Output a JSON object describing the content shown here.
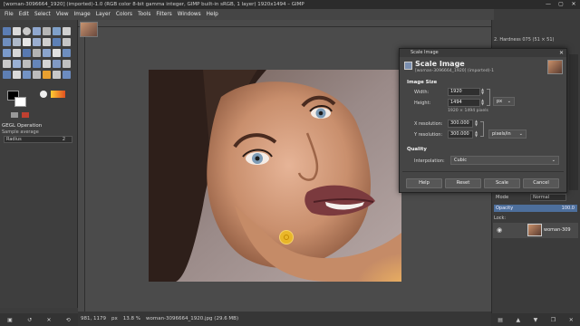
{
  "window": {
    "title": "[woman-3096664_1920] (imported)-1.0 (RGB color 8-bit gamma integer, GIMP built-in sRGB, 1 layer) 1920x1494 – GIMP",
    "controls": [
      "—",
      "▢",
      "✕"
    ]
  },
  "menubar": [
    "File",
    "Edit",
    "Select",
    "View",
    "Image",
    "Layer",
    "Colors",
    "Tools",
    "Filters",
    "Windows",
    "Help"
  ],
  "toolbox": {
    "gegl_title": "GEGL Operation",
    "gegl_op": "Sample average",
    "radius_label": "Radius",
    "radius_value": "2"
  },
  "rightpanel": {
    "brush_label": "2. Hardness 075 (51 × 51)",
    "mode_label": "Mode",
    "mode_value": "Normal",
    "opacity_label": "Opacity",
    "opacity_value": "100.0",
    "lock_label": "Lock:",
    "layer_name": "woman-309"
  },
  "statusbar": {
    "coords": "981, 1179",
    "unit": "px",
    "zoom": "13.8 %",
    "file": "woman-3096664_1920.jpg (29.6 MB)"
  },
  "dialog": {
    "window_title": "Scale Image",
    "heading": "Scale Image",
    "subtitle": "[woman-3096664_1920] (imported)-1",
    "section_size": "Image Size",
    "width_label": "Width:",
    "width_value": "1920",
    "height_label": "Height:",
    "height_value": "1494",
    "size_unit": "px",
    "pixels_info": "1920 × 1494 pixels",
    "xres_label": "X resolution:",
    "xres_value": "300.000",
    "yres_label": "Y resolution:",
    "yres_value": "300.000",
    "res_unit": "pixels/in",
    "section_quality": "Quality",
    "interp_label": "Interpolation:",
    "interp_value": "Cubic",
    "buttons": [
      "Help",
      "Reset",
      "Scale",
      "Cancel"
    ]
  },
  "colors": {
    "accent": "#4d6f9c",
    "cursor": "#f0be1e"
  }
}
